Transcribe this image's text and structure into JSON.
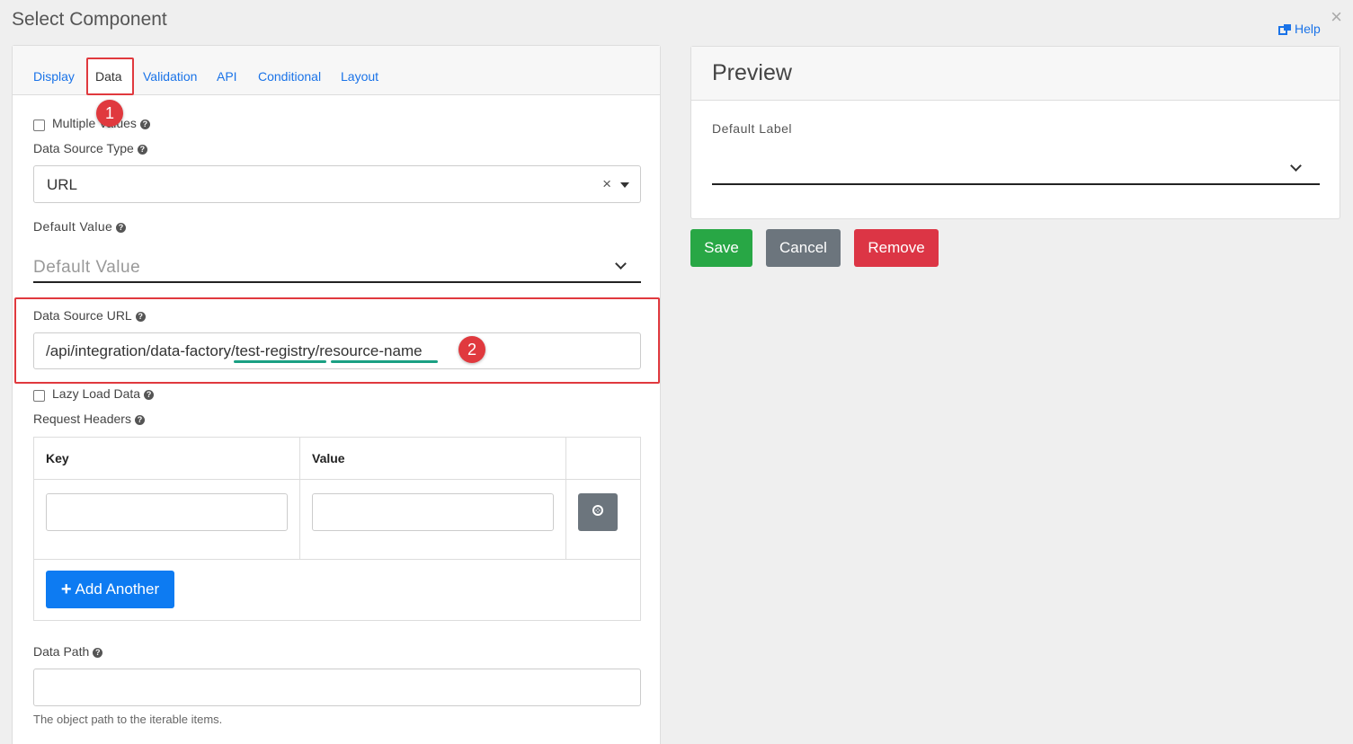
{
  "dialog": {
    "title": "Select Component",
    "help_label": "Help",
    "close_glyph": "×"
  },
  "tabs": [
    {
      "label": "Display",
      "active": false
    },
    {
      "label": "Data",
      "active": true
    },
    {
      "label": "Validation",
      "active": false
    },
    {
      "label": "API",
      "active": false
    },
    {
      "label": "Conditional",
      "active": false
    },
    {
      "label": "Layout",
      "active": false
    }
  ],
  "annotations": {
    "badge_1": "1",
    "badge_2": "2",
    "highlight_color": "#e0393e"
  },
  "form": {
    "multiple_values_label": "Multiple Values",
    "multiple_values_checked": false,
    "data_source_type_label": "Data Source Type",
    "data_source_type_value": "URL",
    "default_value_label": "Default Value",
    "default_value_placeholder": "Default Value",
    "data_source_url_label": "Data Source URL",
    "data_source_url_value": "/api/integration/data-factory/test-registry/resource-name",
    "lazy_load_label": "Lazy Load Data",
    "lazy_load_checked": false,
    "request_headers_label": "Request Headers",
    "headers_table": {
      "columns": [
        "Key",
        "Value"
      ],
      "rows": [
        {
          "key": "",
          "value": ""
        }
      ],
      "add_another_label": "Add Another"
    },
    "data_path_label": "Data Path",
    "data_path_value": "",
    "data_path_help": "The object path to the iterable items."
  },
  "preview": {
    "title": "Preview",
    "field_label": "Default Label"
  },
  "actions": {
    "save_label": "Save",
    "cancel_label": "Cancel",
    "remove_label": "Remove",
    "save_color": "#28a745",
    "cancel_color": "#6c757d",
    "remove_color": "#dc3545"
  }
}
